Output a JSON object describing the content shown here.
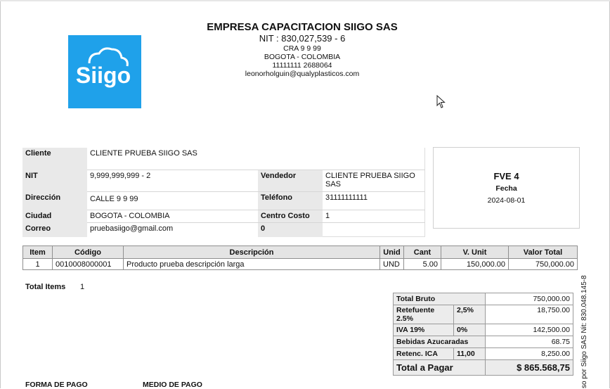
{
  "company": {
    "name": "EMPRESA CAPACITACION SIIGO SAS",
    "nit": "NIT : 830,027,539 - 6",
    "address": "CRA 9 9 99",
    "city": "BOGOTA - COLOMBIA",
    "phones": "11111111 2688064",
    "email": "leonorholguin@qualyplasticos.com",
    "logo_text": "Siigo"
  },
  "client": {
    "cliente_label": "Cliente",
    "cliente_value": "CLIENTE PRUEBA SIIGO SAS",
    "nit_label": "NIT",
    "nit_value": "9,999,999,999 - 2",
    "vendedor_label": "Vendedor",
    "vendedor_value": "CLIENTE PRUEBA SIIGO SAS",
    "direccion_label": "Dirección",
    "direccion_value": "CALLE 9 9 99",
    "telefono_label": "Teléfono",
    "telefono_value": "31111111111",
    "ciudad_label": "Ciudad",
    "ciudad_value": "BOGOTA - COLOMBIA",
    "centro_label": "Centro Costo",
    "centro_value": "1",
    "correo_label": "Correo",
    "correo_value": "pruebasiigo@gmail.com",
    "zero_label": "0"
  },
  "invoice": {
    "number": "FVE 4",
    "date_label": "Fecha",
    "date": "2024-08-01"
  },
  "items_table": {
    "headers": [
      "Item",
      "Código",
      "Descripción",
      "Unid",
      "Cant",
      "V. Unit",
      "Valor Total"
    ],
    "rows": [
      [
        "1",
        "0010008000001",
        "Producto prueba descripción larga",
        "UND",
        "5.00",
        "150,000.00",
        "750,000.00"
      ]
    ]
  },
  "total_items": {
    "label": "Total Items",
    "value": "1"
  },
  "totals": {
    "bruto_label": "Total Bruto",
    "bruto_value": "750,000.00",
    "retefuente_label": "Retefuente 2.5%",
    "retefuente_rate": "2,5%",
    "retefuente_value": "18,750.00",
    "iva_label": "IVA 19%",
    "iva_rate": "0%",
    "iva_value": "142,500.00",
    "bebidas_label": "Bebidas Azucaradas",
    "bebidas_value": "68.75",
    "ica_label": "Retenc. ICA",
    "ica_rate": "11,00",
    "ica_value": "8,250.00",
    "pagar_label": "Total a Pagar",
    "pagar_value": "$ 865.568,75"
  },
  "footer": {
    "forma_pago": "FORMA DE PAGO",
    "medio_pago": "MEDIO DE PAGO"
  },
  "vertical_text": "so por Siigo SAS Nit: 830.048.145-8",
  "colors": {
    "logo_bg": "#1fa1ea",
    "label_bg": "#e9e9e9",
    "header_bg": "#e4e4e4"
  }
}
